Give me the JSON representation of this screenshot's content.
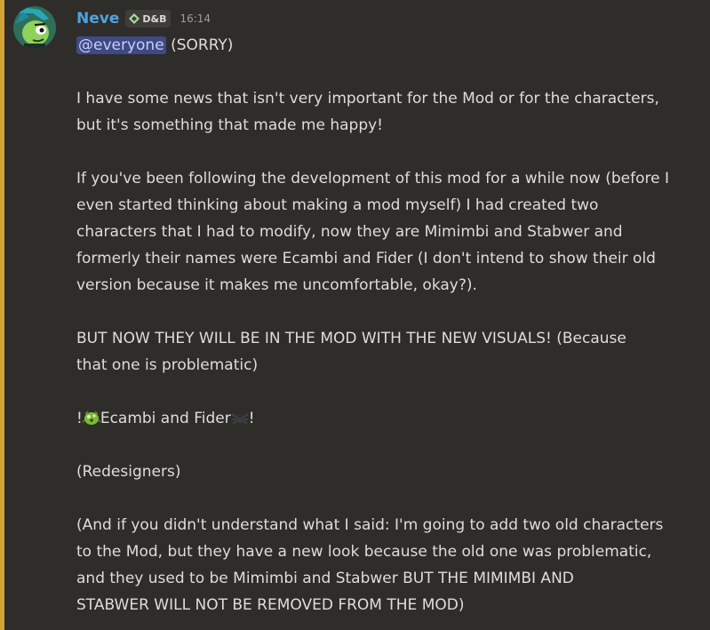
{
  "author": {
    "name": "Neve",
    "tag": "D&B",
    "timestamp": "16:14"
  },
  "message": {
    "mention": "@everyone",
    "mention_suffix": " (SORRY)",
    "lines": [
      "I have some news that isn't very important for the Mod or for the characters,",
      "but it's something that made me happy!",
      "If you've been following the development of this mod for a while now (before I",
      "even started thinking about making a mod myself) I had created two",
      "characters that I had to modify, now they are Mimimbi and Stabwer and",
      "formerly their names were Ecambi and Fider (I don't intend to show their old",
      "version because it makes me uncomfortable, okay?).",
      "BUT NOW THEY WILL BE IN THE MOD WITH THE NEW VISUALS! (Because",
      "that one is problematic)",
      "(Redesigners)",
      "(And if you didn't understand what I said: I'm going to add two old characters",
      "to the Mod, but they have a new look because the old one was problematic,",
      "and they used to be Mimimbi and Stabwer BUT THE MIMIMBI AND",
      "STABWER WILL NOT BE REMOVED FROM THE MOD)"
    ],
    "exclaim_prefix": "!",
    "exclaim_names": "Ecambi and Fider",
    "exclaim_suffix": "!",
    "emoji_1": "green-creature-emoji",
    "emoji_2": "dark-spider-emoji"
  },
  "colors": {
    "mention_bar": "#d3a334",
    "username": "#4fa3e0",
    "mention_bg": "#3e4a83"
  }
}
